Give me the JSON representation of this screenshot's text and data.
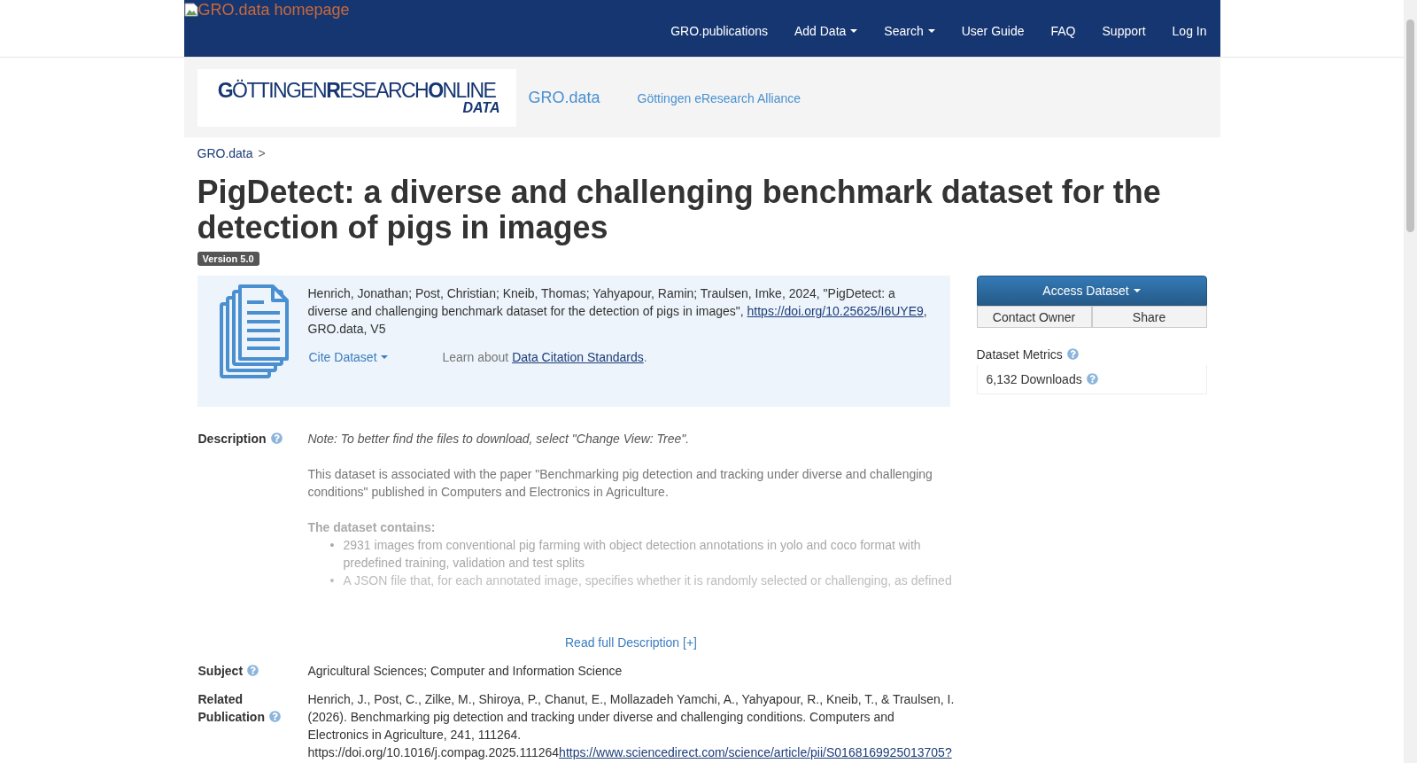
{
  "navbar": {
    "logo_alt": "GRO.data homepage",
    "items": [
      {
        "label": "GRO.publications",
        "dropdown": false
      },
      {
        "label": "Add Data",
        "dropdown": true
      },
      {
        "label": "Search",
        "dropdown": true
      },
      {
        "label": "User Guide",
        "dropdown": false
      },
      {
        "label": "FAQ",
        "dropdown": false
      },
      {
        "label": "Support",
        "dropdown": false
      },
      {
        "label": "Log In",
        "dropdown": false
      }
    ]
  },
  "header": {
    "logo": {
      "wordmark": "**G**ÖTTINGEN**R**ESEARCH**O**NLINE",
      "subtitle": "DATA"
    },
    "site_link": "GRO.data",
    "partner_link": "Göttingen eResearch Alliance"
  },
  "breadcrumb": {
    "items": [
      {
        "label": "GRO.data"
      }
    ],
    "separator": ">"
  },
  "dataset": {
    "title": "PigDetect: a diverse and challenging benchmark dataset for the detection of pigs in images",
    "version": "Version 5.0",
    "citation": {
      "text": "Henrich, Jonathan; Post, Christian; Kneib, Thomas; Yahyapour, Ramin; Traulsen, Imke, 2024, \"PigDetect: a diverse and challenging benchmark dataset for the detection of pigs in images\", ",
      "doi": "https://doi.org/10.25625/I6UYE9",
      "suffix": ", GRO.data, V5",
      "cite_button": "Cite Dataset",
      "learn_prefix": "Learn about ",
      "learn_link": "Data Citation Standards",
      "learn_suffix": "."
    },
    "fields": [
      {
        "kind": "description",
        "label": "Description",
        "note": "Note: To better find the files to download, select \"Change View: Tree\".",
        "paragraph": "This dataset is associated with the paper \"Benchmarking pig detection and tracking under diverse and challenging conditions\" published in Computers and Electronics in Agriculture.",
        "heading": "The dataset contains:",
        "bullet_marker": "•",
        "bullets": [
          "2931 images from conventional pig farming with object detection annotations in yolo and coco format with predefined training, validation and test splits",
          "A JSON file that, for each annotated image, specifies whether it is randomly selected or challenging, as defined"
        ],
        "more": "Read full Description [+]"
      },
      {
        "kind": "text",
        "label": "Subject",
        "value": "Agricultural Sciences; Computer and Information Science"
      },
      {
        "kind": "publication",
        "label": "Related Publication",
        "value": "Henrich, J., Post, C., Zilke, M., Shiroya, P., Chanut, E., Mollazadeh Yamchi, A., Yahyapour, R., Kneib, T., & Traulsen, I. (2026). Benchmarking pig detection and tracking under diverse and challenging conditions. Computers and Electronics in Agriculture, 241, 111264. https://doi.org/10.1016/j.compag.2025.111264",
        "link": "https://www.sciencedirect.com/science/article/pii/S0168169925013705?"
      }
    ]
  },
  "sidebar": {
    "access_button": "Access Dataset",
    "buttons": [
      "Contact Owner",
      "Share"
    ],
    "metrics_title": "Dataset Metrics",
    "downloads": "6,132 Downloads"
  }
}
